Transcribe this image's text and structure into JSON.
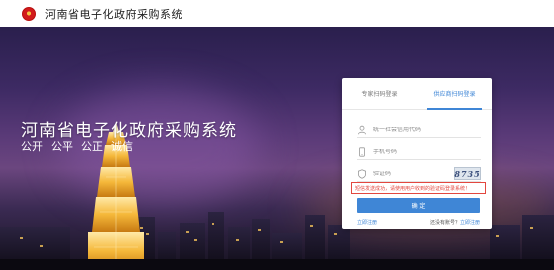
{
  "header": {
    "title": "河南省电子化政府采购系统"
  },
  "hero": {
    "title": "河南省电子化政府采购系统",
    "tags": [
      "公开",
      "公平",
      "公正",
      "诚信"
    ]
  },
  "login": {
    "tabs": [
      {
        "label": "专家扫码登录",
        "active": false
      },
      {
        "label": "供应商扫码登录",
        "active": true
      }
    ],
    "fields": {
      "credit_code_placeholder": "统一社会信用代码",
      "phone_placeholder": "手机号码",
      "captcha_placeholder": "验证码"
    },
    "captcha_text": "8735",
    "error_message": "短信发送成功，请使用用户收到的验证码登录系统！",
    "submit_label": "确 定",
    "register_link": "立即注册",
    "bind_text": "还没有账号？",
    "bind_link": "立即注册"
  },
  "colors": {
    "accent": "#3f86d6",
    "error": "#e3473f"
  }
}
